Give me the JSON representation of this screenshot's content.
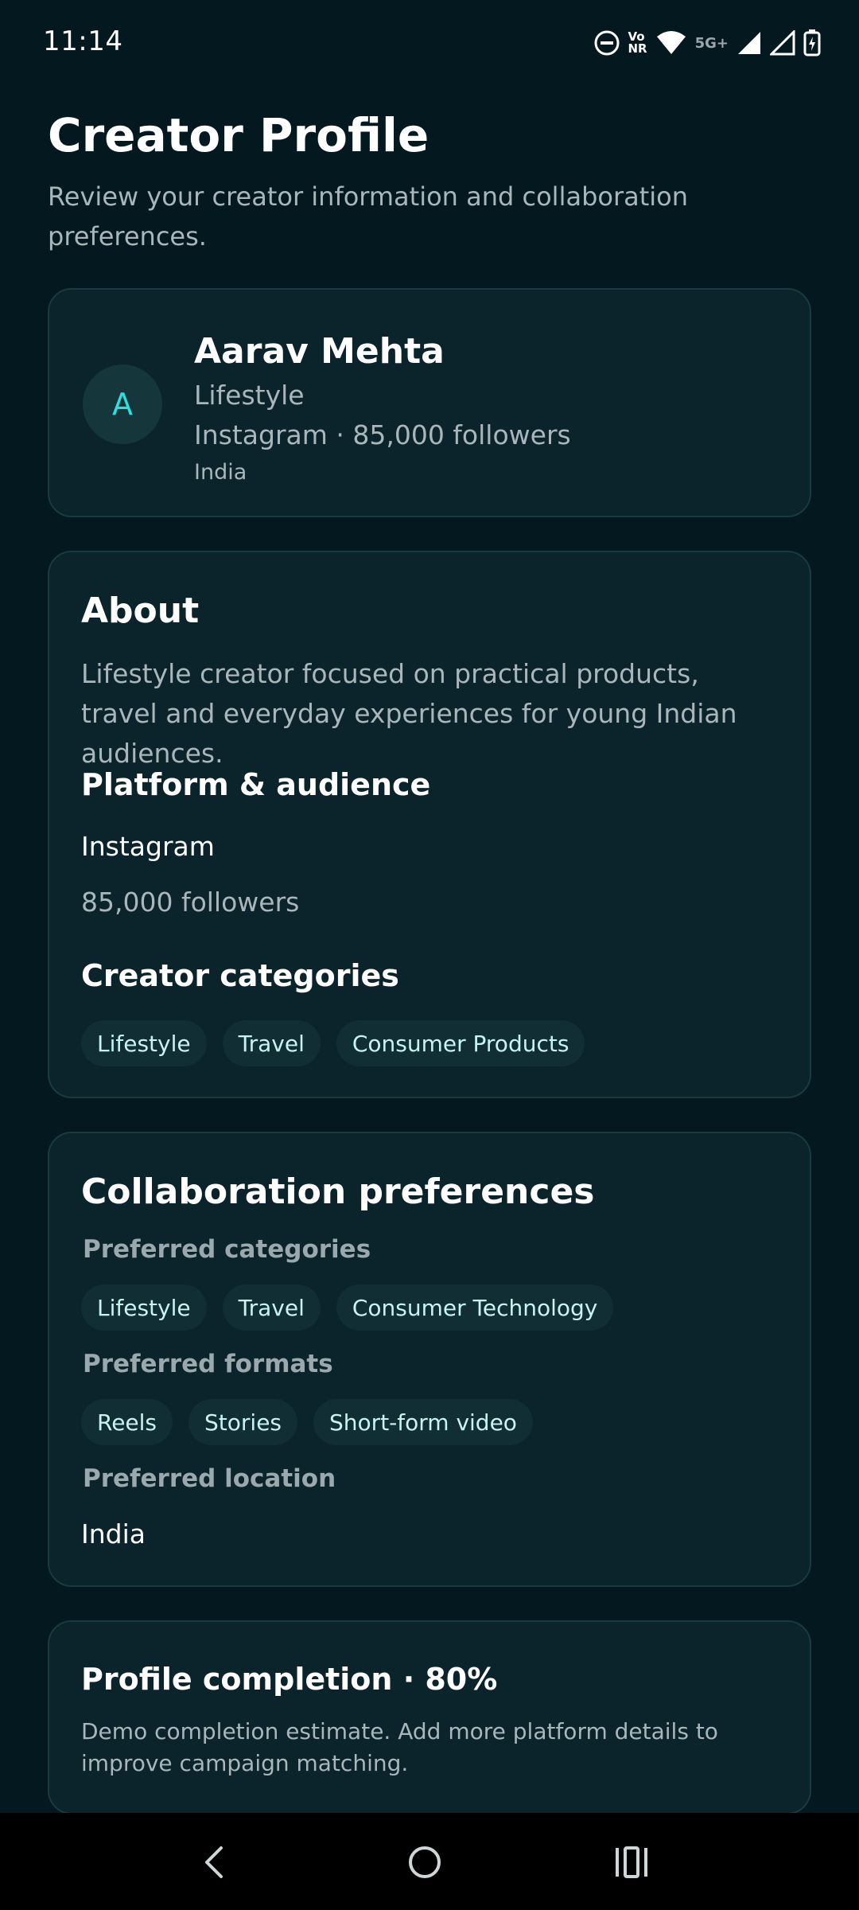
{
  "status_bar": {
    "time": "11:14",
    "volte_top": "Vo",
    "volte_bottom": "NR",
    "network": "5G+",
    "icons": [
      "do-not-disturb-icon",
      "volte-icon",
      "wifi-icon",
      "signal-icon",
      "signal-icon",
      "battery-charging-icon"
    ]
  },
  "header": {
    "title": "Creator Profile",
    "subtitle": "Review your creator information and collaboration preferences."
  },
  "profile": {
    "avatar_letter": "A",
    "name": "Aarav Mehta",
    "category": "Lifestyle",
    "platform_line": "Instagram · 85,000 followers",
    "country": "India"
  },
  "about": {
    "heading": "About",
    "description": "Lifestyle creator focused on practical products, travel and everyday experiences for young Indian audiences.",
    "platform_heading": "Platform & audience",
    "platform": "Instagram",
    "followers": "85,000 followers",
    "categories_heading": "Creator categories",
    "categories": [
      "Lifestyle",
      "Travel",
      "Consumer Products"
    ]
  },
  "collaboration": {
    "heading": "Collaboration preferences",
    "preferred_categories_label": "Preferred categories",
    "preferred_categories": [
      "Lifestyle",
      "Travel",
      "Consumer Technology"
    ],
    "preferred_formats_label": "Preferred formats",
    "preferred_formats": [
      "Reels",
      "Stories",
      "Short-form video"
    ],
    "preferred_location_label": "Preferred location",
    "preferred_location": "India"
  },
  "completion": {
    "title": "Profile completion · 80%",
    "percent": 80,
    "note": "Demo completion estimate. Add more platform details to improve campaign matching."
  },
  "nav_bar": {
    "icons": [
      "back-icon",
      "home-icon",
      "recents-icon"
    ]
  },
  "colors": {
    "background": "#04191f",
    "card": "#0b232a",
    "card_border": "#1a3a41",
    "accent": "#2ee0dd",
    "chip_bg": "#112e34",
    "muted_text": "#a9b7bb"
  }
}
